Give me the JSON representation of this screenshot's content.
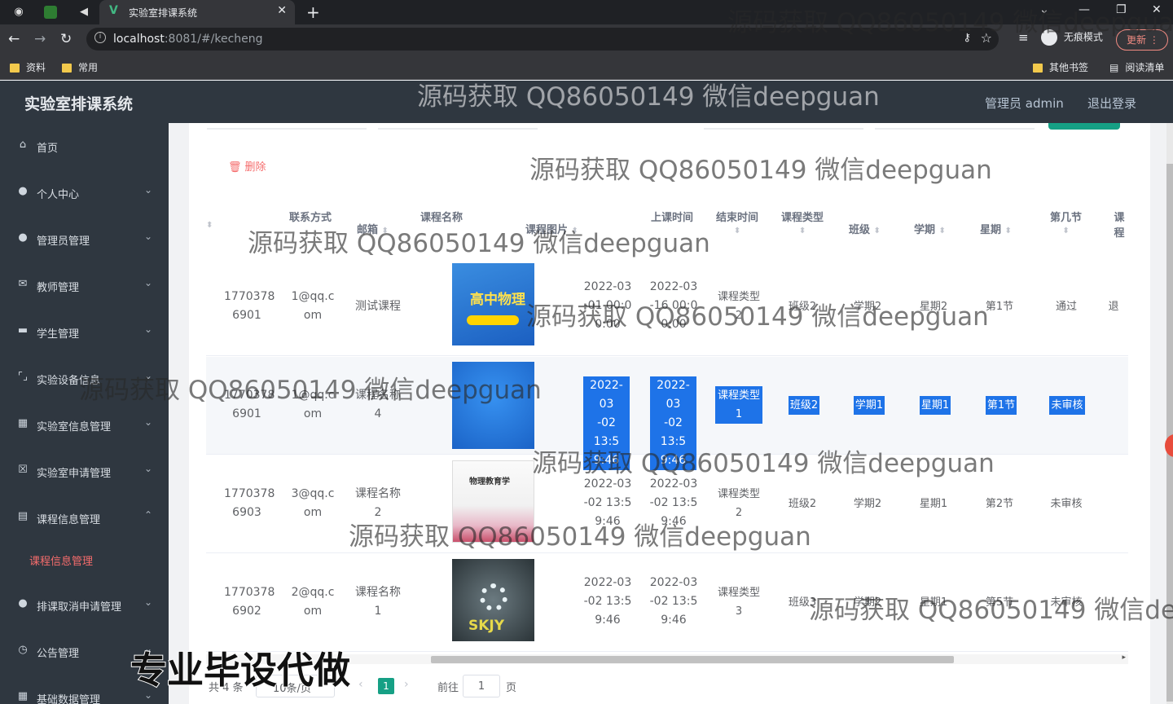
{
  "browser": {
    "tab_title": "实验室排课系统",
    "url_host": "localhost",
    "url_rest": ":8081/#/kecheng",
    "incognito_label": "无痕模式",
    "update_label": "更新",
    "bookmarks": [
      "资料",
      "常用"
    ],
    "other_bookmarks": "其他书签",
    "reading_list": "阅读清单"
  },
  "header": {
    "brand": "实验室排课系统",
    "admin": "管理员 admin",
    "logout": "退出登录"
  },
  "sidebar": {
    "items": [
      {
        "label": "首页",
        "icon": "home-icon"
      },
      {
        "label": "个人中心",
        "icon": "user-icon"
      },
      {
        "label": "管理员管理",
        "icon": "user-icon"
      },
      {
        "label": "教师管理",
        "icon": "mail-icon"
      },
      {
        "label": "学生管理",
        "icon": "briefcase-icon"
      },
      {
        "label": "实验设备信息",
        "icon": "frame-icon"
      },
      {
        "label": "实验室信息管理",
        "icon": "grid-icon"
      },
      {
        "label": "实验室申请管理",
        "icon": "close-box-icon"
      },
      {
        "label": "课程信息管理",
        "icon": "document-icon"
      },
      {
        "label": "排课取消申请管理",
        "icon": "user-icon"
      },
      {
        "label": "公告管理",
        "icon": "clock-icon"
      },
      {
        "label": "基础数据管理",
        "icon": "grid-icon"
      }
    ],
    "active_sub": "课程信息管理"
  },
  "toolbar": {
    "delete_label": "删除"
  },
  "table": {
    "headers": {
      "contact": "联系方式",
      "email": "邮箱",
      "course_name": "课程名称",
      "course_image": "课程图片",
      "start_time": "上课时间",
      "end_time": "结束时间",
      "course_type": "课程类型",
      "class": "班级",
      "term": "学期",
      "weekday": "星期",
      "section": "第几节",
      "audit": "课程"
    },
    "rows": [
      {
        "phone_a": "1770378",
        "phone_b": "6901",
        "email_a": "1@qq.c",
        "email_b": "om",
        "name_a": "测试课程",
        "name_b": "",
        "start_a": "2022-03",
        "start_b": "-01 00:0",
        "start_c": "0:00",
        "end_a": "2022-03",
        "end_b": "-16 00:0",
        "end_c": "0:00",
        "type_a": "课程类型",
        "type_b": "2",
        "class": "班级2",
        "term": "学期2",
        "weekday": "星期2",
        "section": "第1节",
        "status": "通过",
        "extra": "退"
      },
      {
        "phone_a": "1770378",
        "phone_b": "6901",
        "email_a": "1@qq.c",
        "email_b": "om",
        "name_a": "课程名称",
        "name_b": "4",
        "start_a": "2022-03",
        "start_b": "-02 13:5",
        "start_c": "9:46",
        "end_a": "2022-03",
        "end_b": "-02 13:5",
        "end_c": "9:46",
        "type_a": "课程类型",
        "type_b": "1",
        "class": "班级2",
        "term": "学期1",
        "weekday": "星期1",
        "section": "第1节",
        "status": "未审核",
        "extra": ""
      },
      {
        "phone_a": "1770378",
        "phone_b": "6903",
        "email_a": "3@qq.c",
        "email_b": "om",
        "name_a": "课程名称",
        "name_b": "2",
        "start_a": "2022-03",
        "start_b": "-02 13:5",
        "start_c": "9:46",
        "end_a": "2022-03",
        "end_b": "-02 13:5",
        "end_c": "9:46",
        "type_a": "课程类型",
        "type_b": "2",
        "class": "班级2",
        "term": "学期2",
        "weekday": "星期1",
        "section": "第2节",
        "status": "未审核",
        "extra": ""
      },
      {
        "phone_a": "1770378",
        "phone_b": "6902",
        "email_a": "2@qq.c",
        "email_b": "om",
        "name_a": "课程名称",
        "name_b": "1",
        "start_a": "2022-03",
        "start_b": "-02 13:5",
        "start_c": "9:46",
        "end_a": "2022-03",
        "end_b": "-02 13:5",
        "end_c": "9:46",
        "type_a": "课程类型",
        "type_b": "3",
        "class": "班级3",
        "term": "学期2",
        "weekday": "星期1",
        "section": "第5节",
        "status": "未审核",
        "extra": ""
      }
    ],
    "images": {
      "row0_title": "高中物理",
      "row2_title": "物理教育学",
      "row3_title": "SKJY"
    }
  },
  "pager": {
    "total": "共 4 条",
    "page_size": "10条/页",
    "current": "1",
    "goto": "前往",
    "goto_value": "1",
    "page_suffix": "页"
  },
  "watermarks": {
    "text": "源码获取 QQ86050149 微信deepguan",
    "text_cut": "源码获取 QQ86050149 微信deep",
    "promo": "专业毕设代做"
  }
}
